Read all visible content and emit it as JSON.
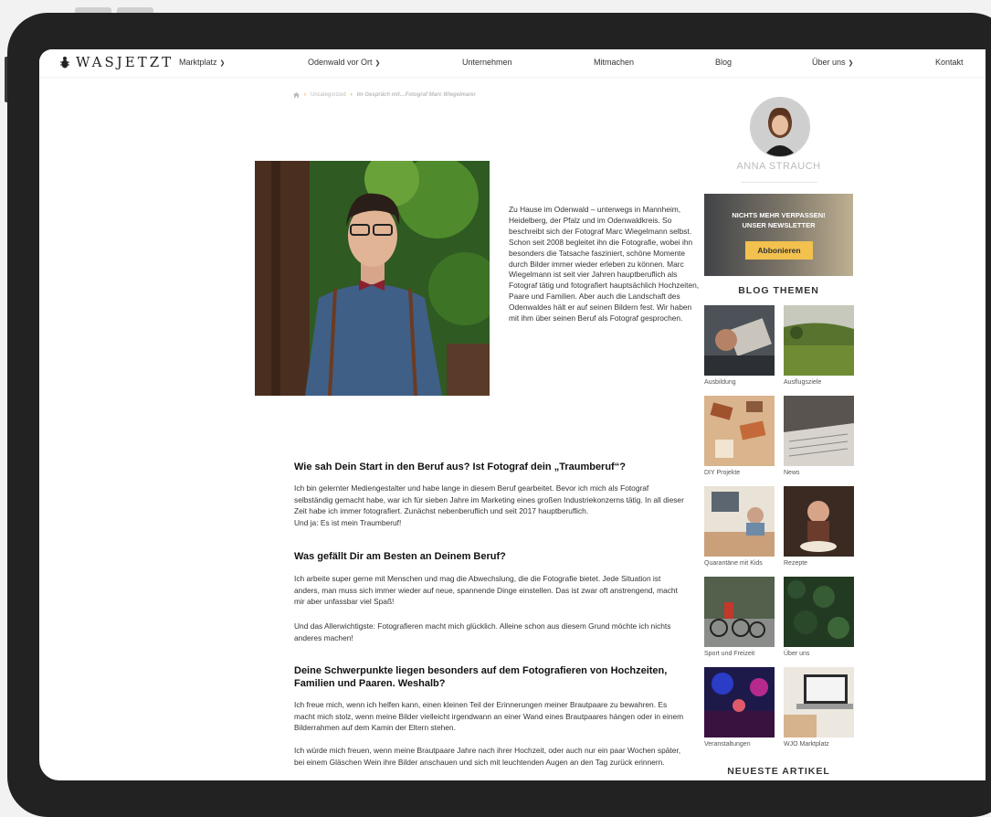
{
  "nav": {
    "logo_text": "WASJETZT",
    "items": [
      {
        "label": "Marktplatz",
        "dropdown": true
      },
      {
        "label": "Odenwald vor Ort",
        "dropdown": true
      },
      {
        "label": "Unternehmen",
        "dropdown": false
      },
      {
        "label": "Mitmachen",
        "dropdown": false
      },
      {
        "label": "Blog",
        "dropdown": false
      },
      {
        "label": "Über uns",
        "dropdown": true
      },
      {
        "label": "Kontakt",
        "dropdown": false
      }
    ]
  },
  "breadcrumb": {
    "home_icon": "home-icon",
    "category": "Uncategorized",
    "current": "Im Gespräch mit…Fotograf Marc Wiegelmann"
  },
  "article": {
    "intro": "Zu Hause im Odenwald – unterwegs in Mannheim, Heidelberg, der Pfalz und im Odenwaldkreis. So beschreibt sich der Fotograf Marc Wiegelmann selbst. Schon seit 2008 begleitet ihn die Fotografie, wobei ihn besonders die Tatsache fasziniert, schöne Momente durch Bilder immer wieder erleben zu können. Marc Wiegelmann ist seit vier Jahren hauptberuflich als Fotograf tätig und fotografiert hauptsächlich Hochzeiten, Paare und Familien. Aber auch die Landschaft des Odenwaldes hält er auf seinen Bildern fest. Wir haben mit ihm über seinen Beruf als Fotograf gesprochen.",
    "q1": "Wie sah Dein Start in den Beruf aus? Ist Fotograf dein „Traumberuf“?",
    "a1": "Ich bin gelernter Mediengestalter und habe lange in diesem Beruf gearbeitet. Bevor ich mich als Fotograf selbständig gemacht habe, war ich für sieben Jahre im Marketing eines großen Industriekonzerns tätig. In all dieser Zeit habe ich immer fotografiert. Zunächst nebenberuflich und seit 2017 hauptberuflich.\nUnd ja: Es ist mein Traumberuf!",
    "q2": "Was gefällt Dir am Besten an Deinem Beruf?",
    "a2a": "Ich arbeite super gerne mit Menschen und mag die Abwechslung, die die Fotografie bietet. Jede Situation ist anders, man muss sich immer wieder auf neue, spannende Dinge einstellen. Das ist zwar oft anstrengend, macht mir aber unfassbar viel Spaß!",
    "a2b": "Und das Allerwichtigste: Fotografieren macht mich glücklich. Alleine schon aus diesem Grund möchte ich nichts anderes machen!",
    "q3": "Deine Schwerpunkte liegen besonders auf dem Fotografieren von Hochzeiten, Familien und Paaren. Weshalb?",
    "a3a": "Ich freue mich, wenn ich helfen kann, einen kleinen Teil der Erinnerungen meiner Brautpaare zu bewahren. Es macht mich stolz, wenn meine Bilder vielleicht irgendwann an einer Wand eines Brautpaares hängen oder in einem Bilderrahmen auf dem Kamin der Eltern stehen.",
    "a3b": "Ich würde mich freuen, wenn meine Brautpaare Jahre nach ihrer Hochzeit, oder auch nur ein paar Wochen später, bei einem Gläschen Wein ihre Bilder anschauen und sich mit leuchtenden Augen an den Tag zurück erinnern."
  },
  "sidebar": {
    "author": "ANNA STRAUCH",
    "newsletter": {
      "line1": "NICHTS MEHR VERPASSEN!",
      "line2": "UNSER NEWSLETTER",
      "button": "Abbonieren"
    },
    "blog_topics_title": "BLOG THEMEN",
    "topics": [
      "Ausbildung",
      "Ausflugsziele",
      "DIY Projekte",
      "News",
      "Quarantäne mit Kids",
      "Rezepte",
      "Sport und Freizeit",
      "Über uns",
      "Veranstaltungen",
      "WJO Marktplatz"
    ],
    "latest_title": "NEUESTE ARTIKEL"
  },
  "colors": {
    "accent": "#f0a000",
    "button": "#f2c14e",
    "device_frame": "#222222"
  }
}
